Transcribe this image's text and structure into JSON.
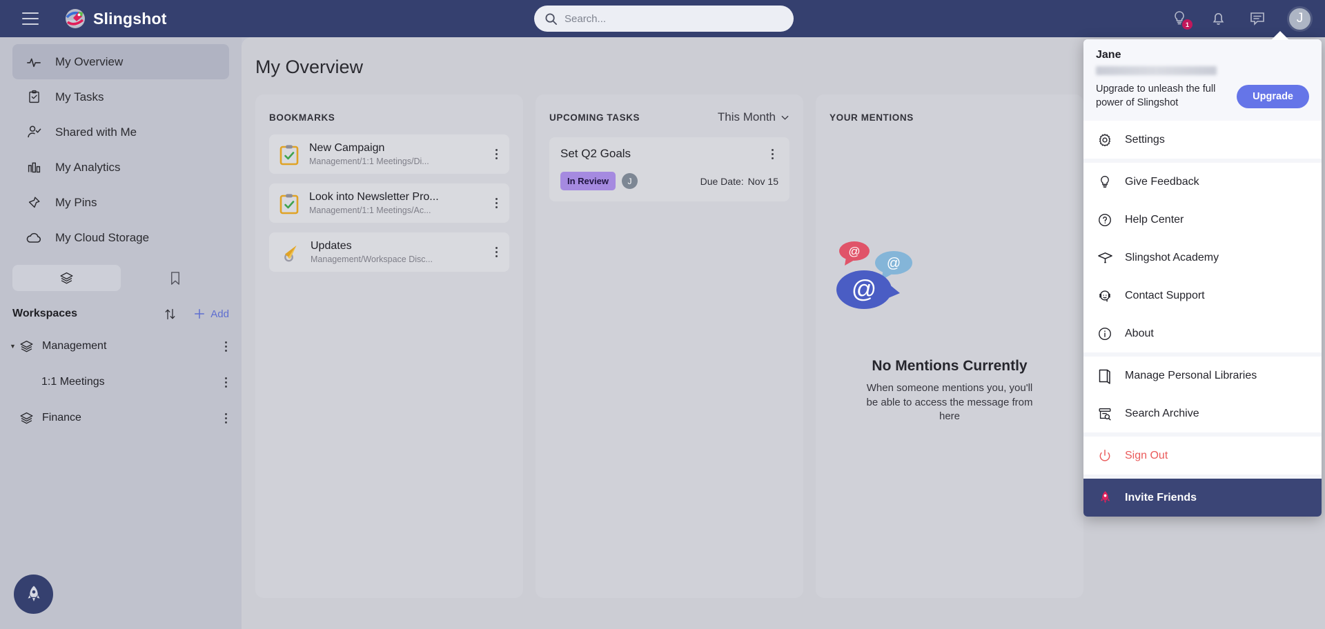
{
  "topbar": {
    "brand": "Slingshot",
    "menu_icon": "hamburger-icon",
    "search_placeholder": "Search...",
    "search_value": "",
    "feedback_badge": "1",
    "avatar_initial": "J"
  },
  "sidebar": {
    "nav": [
      {
        "label": "My Overview",
        "icon": "activity-icon",
        "active": true
      },
      {
        "label": "My Tasks",
        "icon": "clipboard-check-icon",
        "active": false
      },
      {
        "label": "Shared with Me",
        "icon": "user-check-icon",
        "active": false
      },
      {
        "label": "My Analytics",
        "icon": "bar-chart-icon",
        "active": false
      },
      {
        "label": "My Pins",
        "icon": "pin-icon",
        "active": false
      },
      {
        "label": "My Cloud Storage",
        "icon": "cloud-icon",
        "active": false
      }
    ],
    "tabs": [
      {
        "name": "workspaces-tab",
        "icon": "layers-icon",
        "active": true
      },
      {
        "name": "bookmarks-tab",
        "icon": "bookmark-icon",
        "active": false
      }
    ],
    "workspaces_title": "Workspaces",
    "sort_icon": "sort-arrows-icon",
    "add_label": "Add",
    "add_icon": "plus-icon",
    "tree": [
      {
        "label": "Management",
        "icon": "layers-icon",
        "expanded": true,
        "child": false
      },
      {
        "label": "1:1 Meetings",
        "icon": "",
        "expanded": false,
        "child": true
      },
      {
        "label": "Finance",
        "icon": "layers-icon",
        "expanded": false,
        "child": false
      }
    ],
    "fab_icon": "rocket-icon"
  },
  "main": {
    "page_title": "My Overview",
    "bookmarks": {
      "title": "BOOKMARKS",
      "items": [
        {
          "title": "New Campaign",
          "subtitle": "Management/1:1 Meetings/Di...",
          "icon": "task-clipboard-icon"
        },
        {
          "title": "Look into Newsletter Pro...",
          "subtitle": "Management/1:1 Meetings/Ac...",
          "icon": "task-clipboard-icon"
        },
        {
          "title": "Updates",
          "subtitle": "Management/Workspace Disc...",
          "icon": "megaphone-icon"
        }
      ]
    },
    "upcoming_tasks": {
      "title": "UPCOMING TASKS",
      "filter_label": "This Month",
      "filter_icon": "chevron-down-icon",
      "items": [
        {
          "name": "Set Q2 Goals",
          "status": "In Review",
          "assignee_initial": "J",
          "due_label": "Due Date:",
          "due_value": "Nov 15"
        }
      ]
    },
    "mentions": {
      "title": "YOUR MENTIONS",
      "empty_title": "No Mentions Currently",
      "empty_subtitle": "When someone mentions you, you'll be able to access the message from here",
      "illustration": "at-mention-bubbles-icon"
    }
  },
  "user_menu": {
    "user_name": "Jane",
    "email_masked": "",
    "upgrade_text": "Upgrade to unleash the full power of Slingshot",
    "upgrade_button": "Upgrade",
    "items": [
      {
        "label": "Settings",
        "icon": "gear-icon",
        "group": 1
      },
      {
        "label": "Give Feedback",
        "icon": "lightbulb-icon",
        "group": 2
      },
      {
        "label": "Help Center",
        "icon": "question-circle-icon",
        "group": 2
      },
      {
        "label": "Slingshot Academy",
        "icon": "graduation-cap-icon",
        "group": 2
      },
      {
        "label": "Contact Support",
        "icon": "headset-icon",
        "group": 2
      },
      {
        "label": "About",
        "icon": "info-circle-icon",
        "group": 2
      },
      {
        "label": "Manage Personal Libraries",
        "icon": "book-icon",
        "group": 3
      },
      {
        "label": "Search Archive",
        "icon": "archive-search-icon",
        "group": 3
      },
      {
        "label": "Sign Out",
        "icon": "power-icon",
        "group": 4
      },
      {
        "label": "Invite Friends",
        "icon": "rocket-icon",
        "group": 5
      }
    ]
  },
  "colors": {
    "header_bg": "#35406f",
    "accent_blue": "#6575e8",
    "sign_out_red": "#ea5a5a",
    "invite_bg": "#3b4576",
    "chip_purple": "#a58ae0",
    "badge_pink": "#c2185b"
  }
}
